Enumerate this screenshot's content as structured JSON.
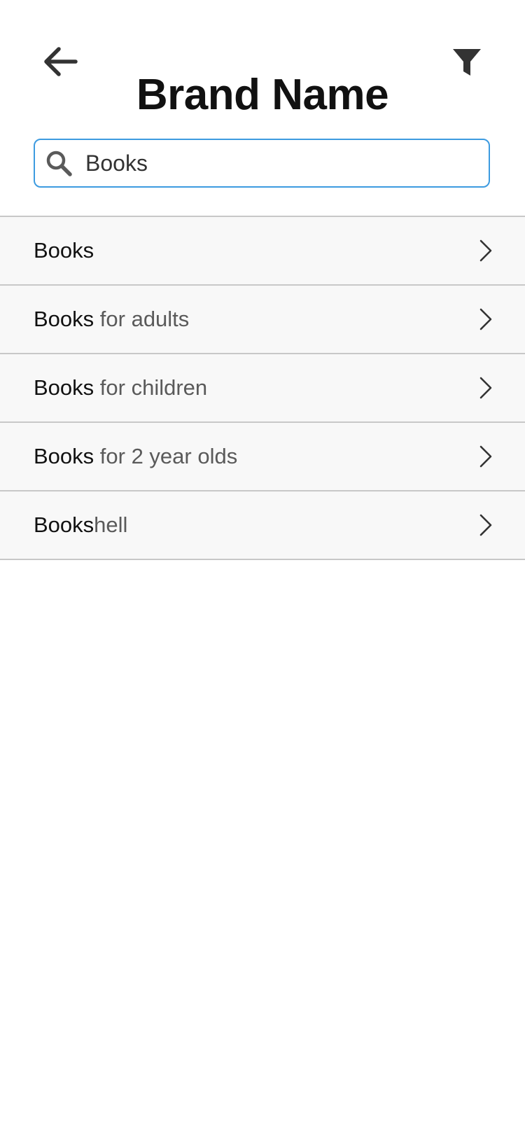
{
  "header": {
    "title": "Brand Name",
    "back_icon": "arrow-left-icon",
    "filter_icon": "filter-funnel-icon"
  },
  "search": {
    "value": "Books",
    "placeholder": "",
    "icon": "search-icon",
    "accent_color": "#3d9be0"
  },
  "results": [
    {
      "match": "Books",
      "rest": ""
    },
    {
      "match": "Books",
      "rest": " for adults"
    },
    {
      "match": "Books",
      "rest": " for children"
    },
    {
      "match": "Books",
      "rest": " for 2 year olds"
    },
    {
      "match": "Books",
      "rest": "hell"
    }
  ],
  "colors": {
    "match_text": "#111111",
    "rest_text": "#5a5a5a",
    "row_background": "#f8f8f8",
    "divider": "#c8c8c8"
  }
}
